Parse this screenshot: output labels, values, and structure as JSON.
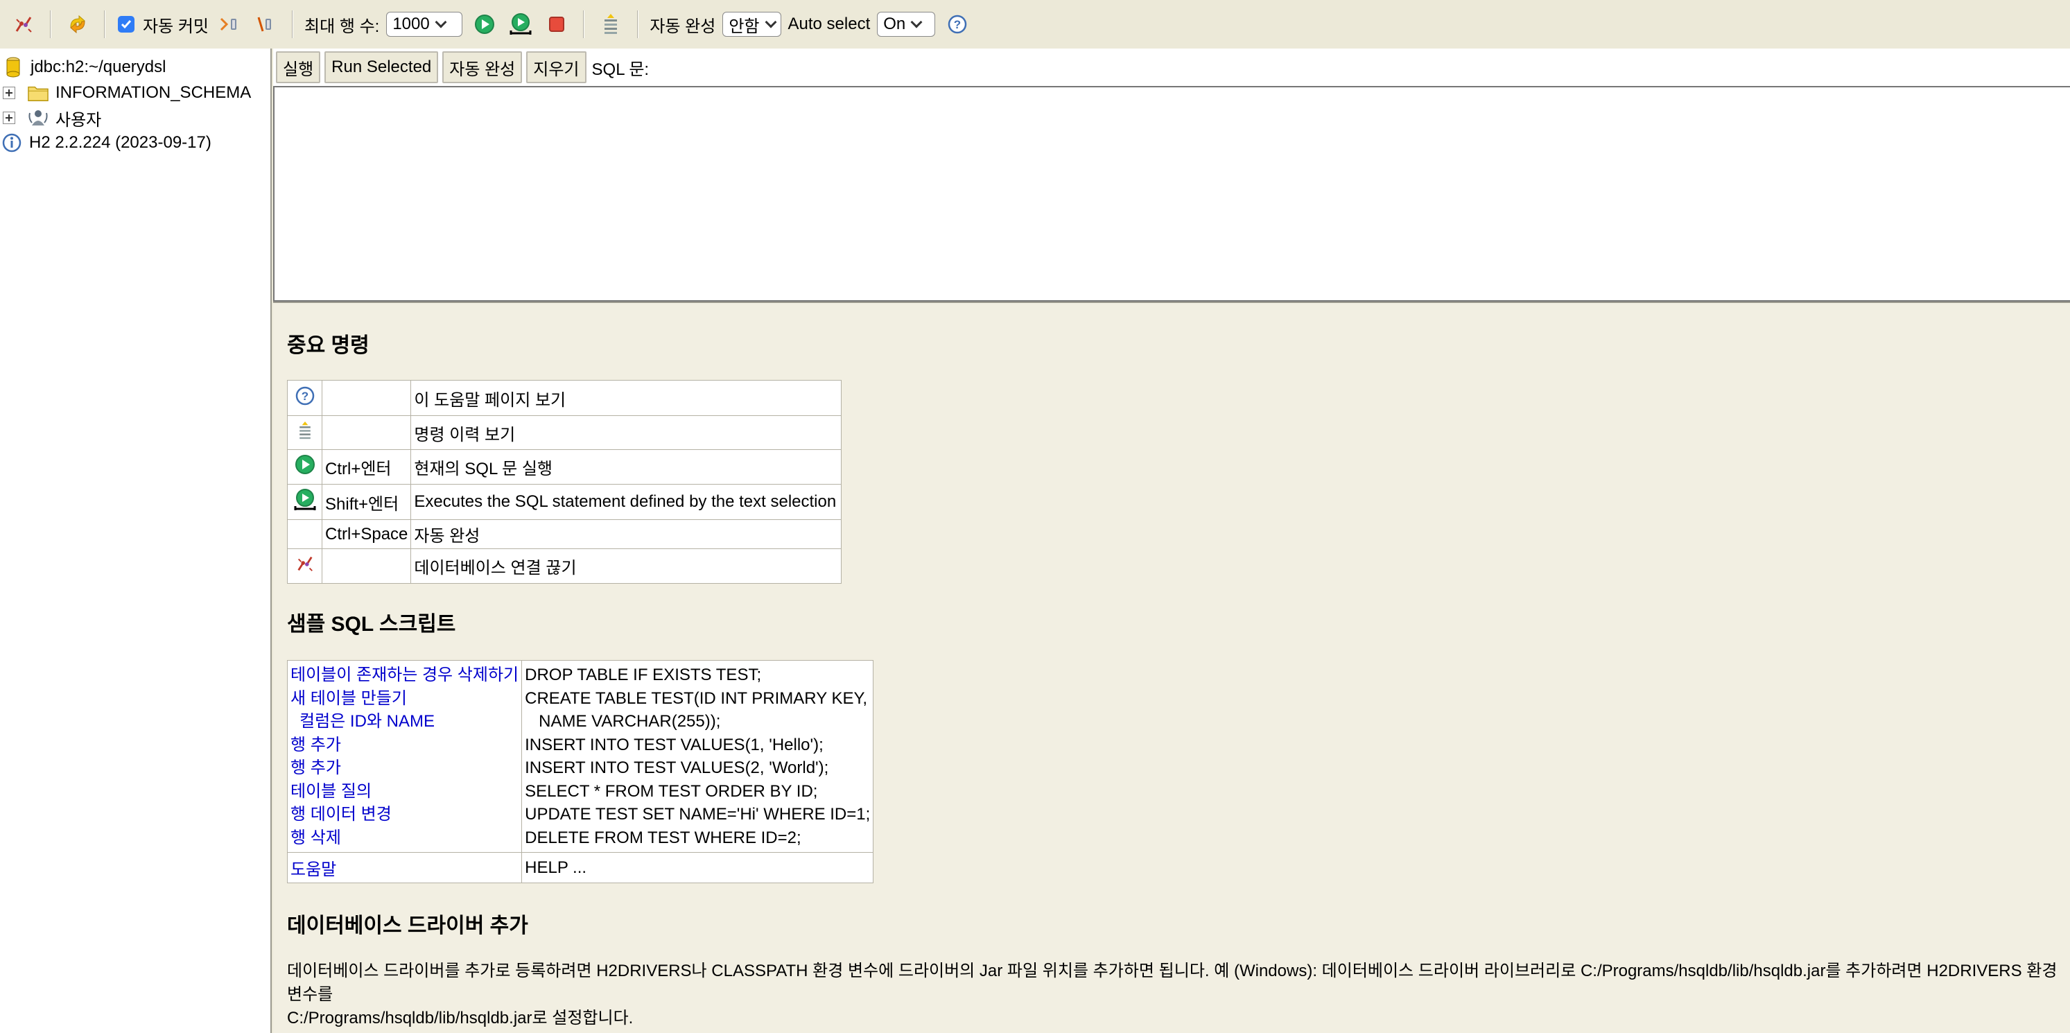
{
  "toolbar": {
    "autocommit_label": "자동 커밋",
    "autocommit_checked": true,
    "max_rows_label": "최대 행 수:",
    "max_rows_value": "1000",
    "autocomplete_label": "자동 완성",
    "autocomplete_value": "안함",
    "autoselect_label": "Auto select",
    "autoselect_value": "On"
  },
  "tree": {
    "connection": "jdbc:h2:~/querydsl",
    "schema": "INFORMATION_SCHEMA",
    "users": "사용자",
    "version": "H2 2.2.224 (2023-09-17)"
  },
  "query": {
    "buttons": {
      "run": "실행",
      "run_selected": "Run Selected",
      "autocomplete": "자동 완성",
      "clear": "지우기"
    },
    "sql_label": "SQL 문:"
  },
  "help": {
    "important_title": "중요 명령",
    "commands": [
      {
        "icon": "help-icon",
        "key": "",
        "desc": "이 도움말 페이지 보기"
      },
      {
        "icon": "history-icon",
        "key": "",
        "desc": "명령 이력 보기"
      },
      {
        "icon": "run-icon",
        "key": "Ctrl+엔터",
        "desc": "현재의 SQL 문 실행"
      },
      {
        "icon": "run-selected-icon",
        "key": "Shift+엔터",
        "desc": "Executes the SQL statement defined by the text selection"
      },
      {
        "icon": "",
        "key": "Ctrl+Space",
        "desc": "자동 완성"
      },
      {
        "icon": "disconnect-icon",
        "key": "",
        "desc": "데이터베이스 연결 끊기"
      }
    ],
    "sample_title": "샘플 SQL 스크립트",
    "samples": [
      {
        "label": "테이블이 존재하는 경우 삭제하기",
        "sql": "DROP TABLE IF EXISTS TEST;"
      },
      {
        "label": "새 테이블 만들기",
        "sql": "CREATE TABLE TEST(ID INT PRIMARY KEY,"
      },
      {
        "label": "  컬럼은 ID와 NAME",
        "sql": "   NAME VARCHAR(255));"
      },
      {
        "label": "행 추가",
        "sql": "INSERT INTO TEST VALUES(1, 'Hello');"
      },
      {
        "label": "행 추가",
        "sql": "INSERT INTO TEST VALUES(2, 'World');"
      },
      {
        "label": "테이블 질의",
        "sql": "SELECT * FROM TEST ORDER BY ID;"
      },
      {
        "label": "행 데이터 변경",
        "sql": "UPDATE TEST SET NAME='Hi' WHERE ID=1;"
      },
      {
        "label": "행 삭제",
        "sql": "DELETE FROM TEST WHERE ID=2;"
      }
    ],
    "help_row": {
      "label": "도움말",
      "sql": "HELP ..."
    },
    "driver_title": "데이터베이스 드라이버 추가",
    "driver_text_line1": "데이터베이스 드라이버를 추가로 등록하려면 H2DRIVERS나 CLASSPATH 환경 변수에 드라이버의 Jar 파일 위치를 추가하면 됩니다. 예 (Windows): 데이터베이스 드라이버 라이브러리로 C:/Programs/hsqldb/lib/hsqldb.jar를 추가하려면 H2DRIVERS 환경 변수를",
    "driver_text_line2": "C:/Programs/hsqldb/lib/hsqldb.jar로 설정합니다."
  }
}
